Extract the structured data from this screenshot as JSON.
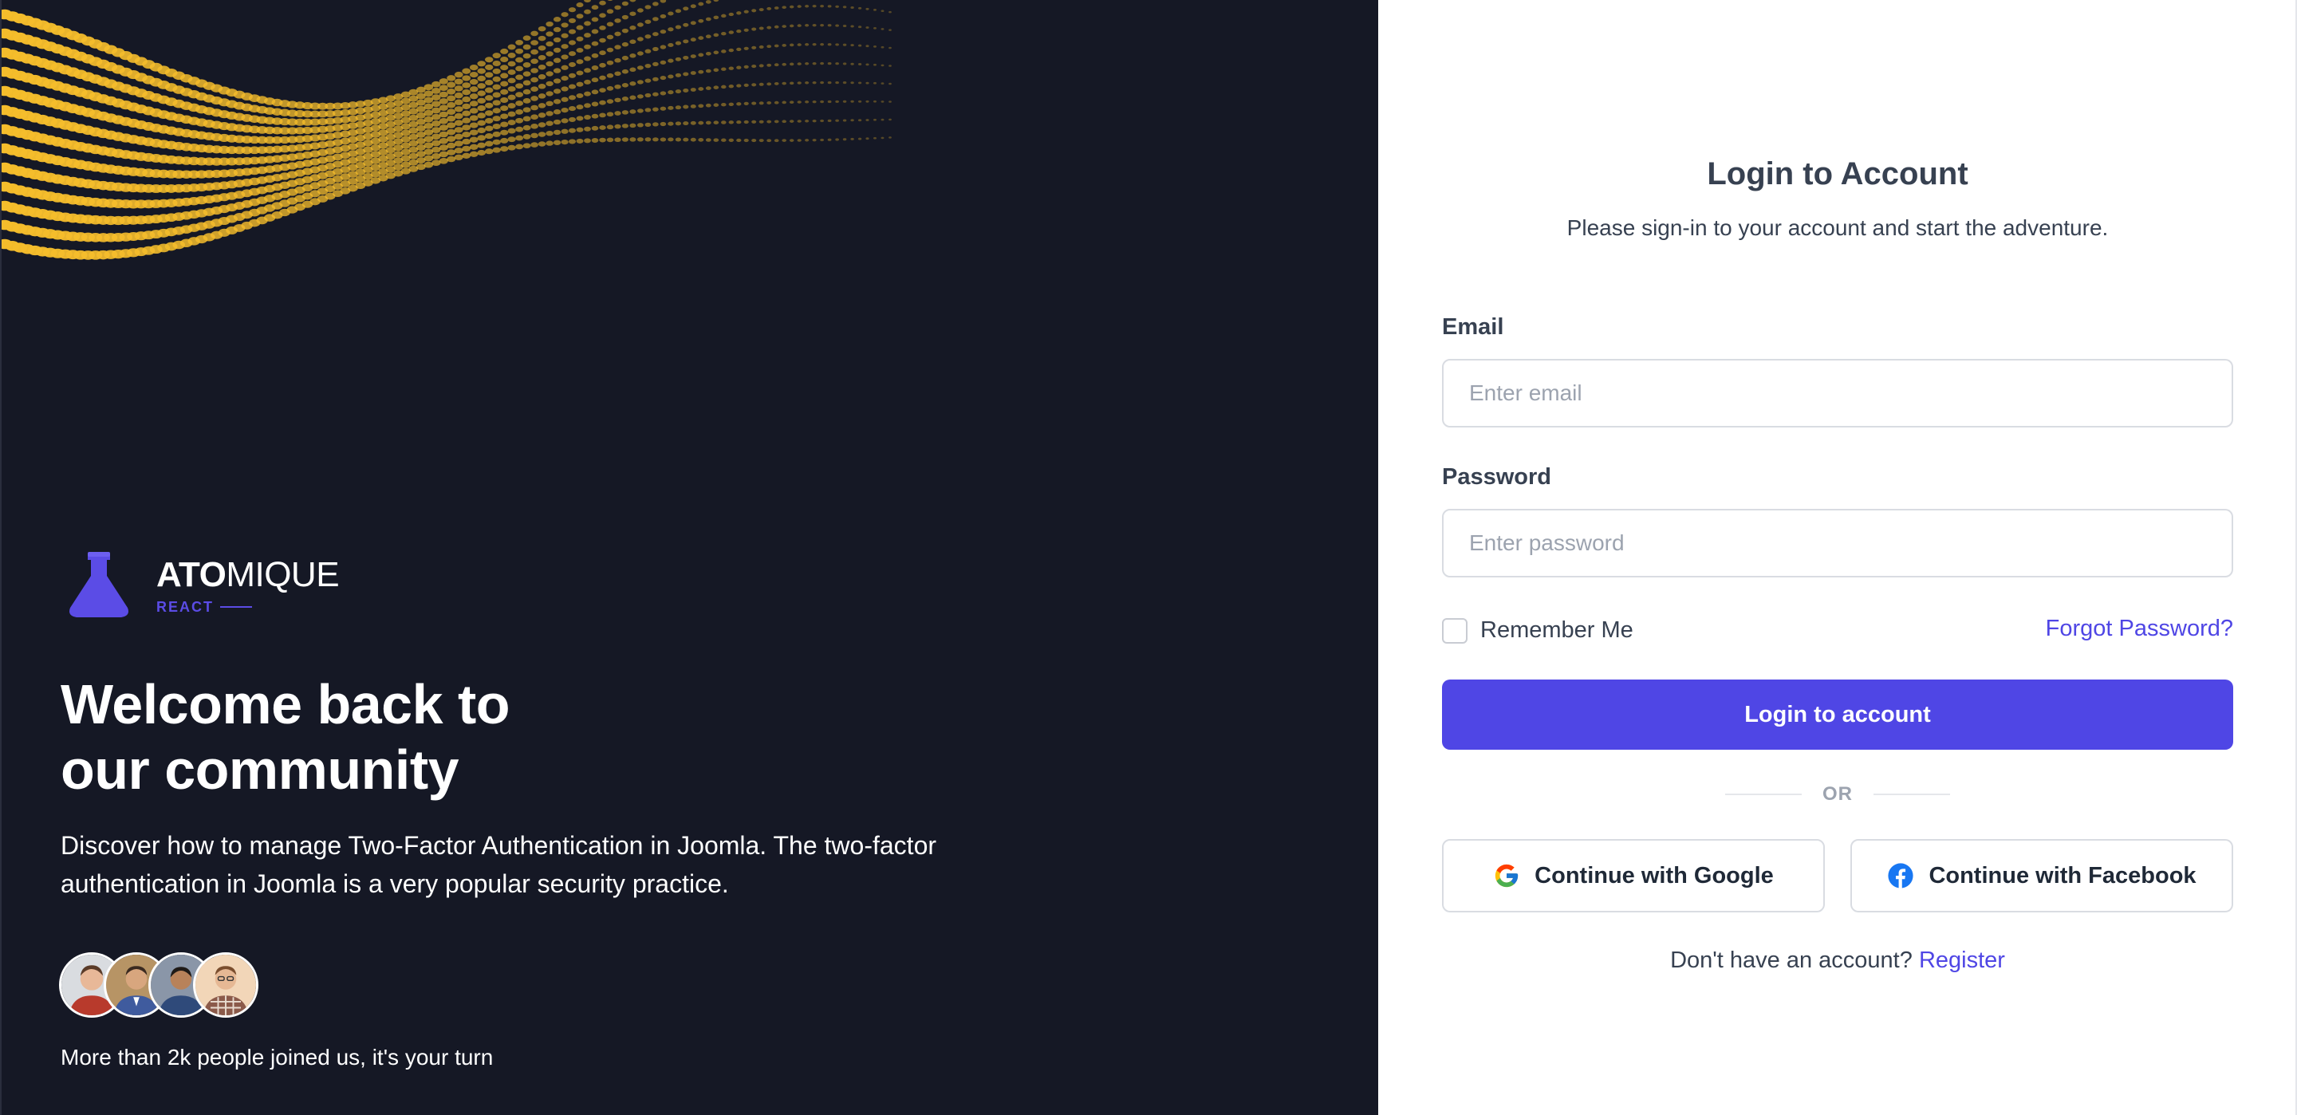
{
  "brand": {
    "name_bold": "ATO",
    "name_light": "MIQUE",
    "sub": "REACT",
    "logo_icon": "flask-icon",
    "accent": "#5b4ce6"
  },
  "hero": {
    "headline_line1": "Welcome back to",
    "headline_line2": "our community",
    "lead": "Discover how to manage Two-Factor Authentication in Joomla. The two-factor authentication in Joomla is a very popular security practice.",
    "joined_text": "More than 2k people joined us, it's your turn",
    "avatars": [
      {
        "icon": "avatar-1"
      },
      {
        "icon": "avatar-2"
      },
      {
        "icon": "avatar-3"
      },
      {
        "icon": "avatar-4"
      }
    ],
    "background": "#151825",
    "wave_color": "#f5bd2c"
  },
  "login": {
    "title": "Login to Account",
    "subtitle": "Please sign-in to your account and start the adventure.",
    "email": {
      "label": "Email",
      "placeholder": "Enter email",
      "value": ""
    },
    "password": {
      "label": "Password",
      "placeholder": "Enter password",
      "value": ""
    },
    "remember_label": "Remember Me",
    "remember_checked": false,
    "forgot_label": "Forgot Password?",
    "submit_label": "Login to account",
    "divider_label": "OR",
    "google_label": "Continue with Google",
    "facebook_label": "Continue with Facebook",
    "register_prompt": "Don't have an account?",
    "register_label": "Register",
    "primary_color": "#4f46e5"
  }
}
